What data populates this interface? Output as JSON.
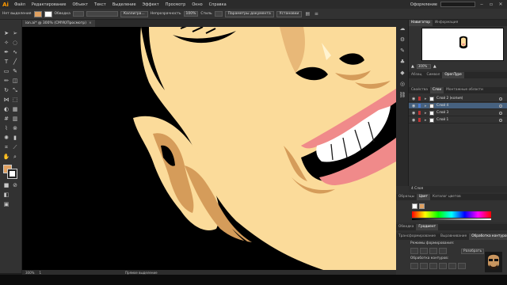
{
  "app": {
    "logo": "Ai",
    "workspace": "Оформление"
  },
  "menu": [
    "Файл",
    "Редактирование",
    "Объект",
    "Текст",
    "Выделение",
    "Эффект",
    "Просмотр",
    "Окно",
    "Справка"
  ],
  "control_bar": {
    "selection_label": "Нет выделения",
    "stroke_label": "Обводка",
    "brush_label": "Каллигра...",
    "opacity_label": "Непрозрачность",
    "opacity_value": "100%",
    "style_label": "Стиль",
    "doc_setup": "Параметры документа",
    "prefs": "Установки",
    "fill_color": "#e0a060"
  },
  "document_tab": {
    "title": "ion.ai* @ 300% (CMYK/Просмотр)",
    "close": "×"
  },
  "status_bar": {
    "zoom": "300%",
    "page": "1",
    "tool": "Прямое выделение"
  },
  "panels": {
    "navigator": {
      "tabs": [
        "Навигатор",
        "Информация"
      ],
      "zoom": "300%"
    },
    "layers_group": {
      "tabs": [
        "Абзац",
        "Символ",
        "OpenType"
      ],
      "subtabs": [
        "Свойства",
        "Слои",
        "Монтажные области"
      ],
      "layers": [
        {
          "name": "Слой 2 (копия)",
          "selected": false
        },
        {
          "name": "Слой 4",
          "selected": true
        },
        {
          "name": "Слой 3",
          "selected": false
        },
        {
          "name": "Слой 1",
          "selected": false
        }
      ],
      "footer": "4 Слоя"
    },
    "swatches": {
      "tabs": [
        "Образцы",
        "Цвет",
        "Каталог цветов"
      ]
    },
    "gradient": {
      "tabs": [
        "Обводка",
        "Градиент"
      ]
    },
    "pathfinder": {
      "tabs": [
        "Трансформирование",
        "Выравнивание",
        "Обработка контуров"
      ],
      "shape_modes": "Режимы формирования:",
      "expand": "Разобрать",
      "pathfinders": "Обработка контуров:"
    }
  },
  "colors": {
    "skin": "#fbdb9a",
    "shadow": "#d59c5a",
    "lip": "#f08a8a",
    "accent": "#ff9a00"
  },
  "icons": [
    "ai-logo",
    "search-icon",
    "minimize-icon",
    "maximize-icon",
    "close-icon",
    "selection-tool-icon",
    "direct-selection-tool-icon",
    "pen-tool-icon",
    "type-tool-icon",
    "eye-icon",
    "lock-icon"
  ]
}
